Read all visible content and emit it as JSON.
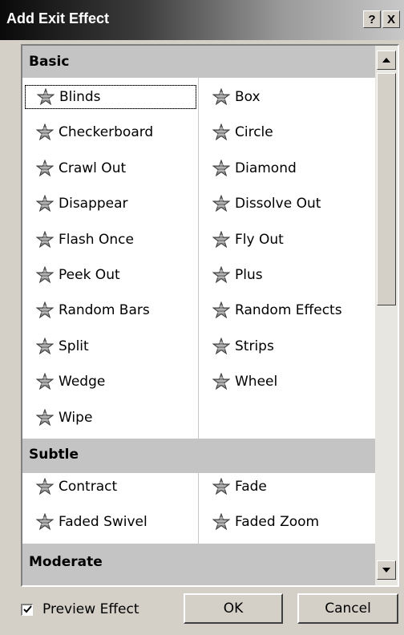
{
  "window": {
    "title": "Add Exit Effect",
    "help_label": "?",
    "close_label": "X"
  },
  "sections": [
    {
      "title": "Basic",
      "items": [
        {
          "label": "Blinds",
          "icon": "star-blinds-icon",
          "selected": true
        },
        {
          "label": "Box",
          "icon": "star-box-icon"
        },
        {
          "label": "Checkerboard",
          "icon": "star-checkerboard-icon"
        },
        {
          "label": "Circle",
          "icon": "star-circle-icon"
        },
        {
          "label": "Crawl Out",
          "icon": "star-crawl-out-icon"
        },
        {
          "label": "Diamond",
          "icon": "star-diamond-icon"
        },
        {
          "label": "Disappear",
          "icon": "star-disappear-icon"
        },
        {
          "label": "Dissolve Out",
          "icon": "star-dissolve-out-icon"
        },
        {
          "label": "Flash Once",
          "icon": "star-flash-once-icon"
        },
        {
          "label": "Fly Out",
          "icon": "star-fly-out-icon"
        },
        {
          "label": "Peek Out",
          "icon": "star-peek-out-icon"
        },
        {
          "label": "Plus",
          "icon": "star-plus-icon"
        },
        {
          "label": "Random Bars",
          "icon": "star-random-bars-icon"
        },
        {
          "label": "Random Effects",
          "icon": "star-random-effects-icon"
        },
        {
          "label": "Split",
          "icon": "star-split-icon"
        },
        {
          "label": "Strips",
          "icon": "star-strips-icon"
        },
        {
          "label": "Wedge",
          "icon": "star-wedge-icon"
        },
        {
          "label": "Wheel",
          "icon": "star-wheel-icon"
        },
        {
          "label": "Wipe",
          "icon": "star-wipe-icon"
        }
      ]
    },
    {
      "title": "Subtle",
      "items": [
        {
          "label": "Contract",
          "icon": "star-contract-icon"
        },
        {
          "label": "Fade",
          "icon": "star-fade-icon"
        },
        {
          "label": "Faded Swivel",
          "icon": "star-faded-swivel-icon"
        },
        {
          "label": "Faded Zoom",
          "icon": "star-faded-zoom-icon"
        }
      ]
    },
    {
      "title": "Moderate",
      "items": []
    }
  ],
  "footer": {
    "preview_label": "Preview Effect",
    "preview_checked": true,
    "ok_label": "OK",
    "cancel_label": "Cancel"
  }
}
